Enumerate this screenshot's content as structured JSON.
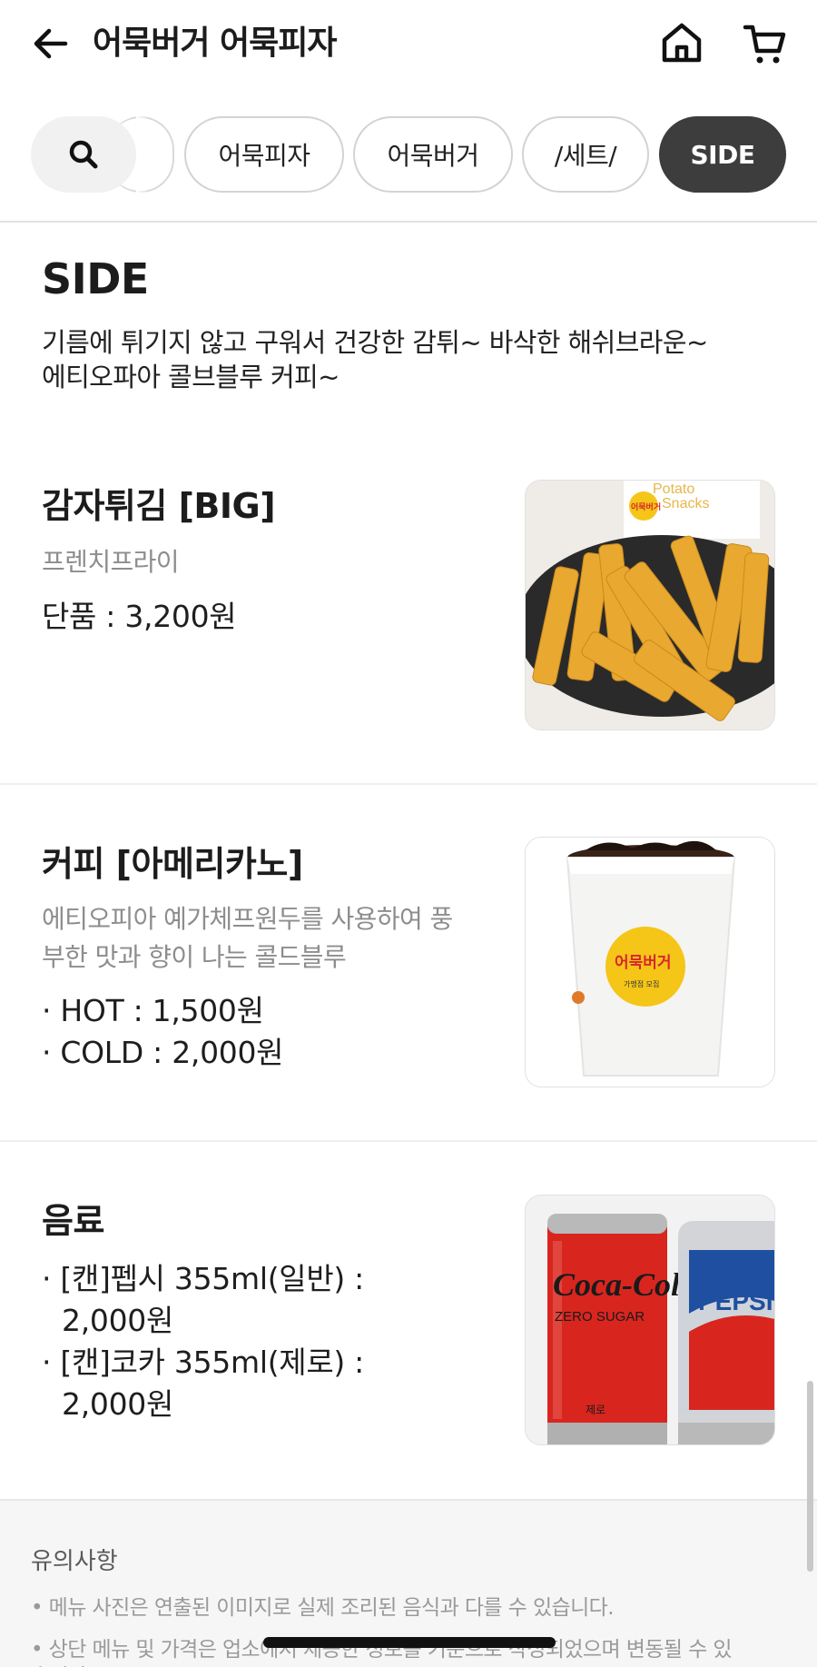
{
  "header": {
    "title": "어묵버거 어묵피자"
  },
  "tabs": [
    {
      "label": "어묵피자"
    },
    {
      "label": "어묵버거"
    },
    {
      "label": "/세트/"
    },
    {
      "label": "SIDE"
    }
  ],
  "section": {
    "title": "SIDE",
    "description_lines": [
      "기름에 튀기지 않고 구워서 건강한 감튀~ 바삭한 해쉬브라운~",
      "에티오파아 콜브블루 커피~"
    ]
  },
  "items": [
    {
      "name": "감자튀김  [BIG]",
      "desc_lines": [
        "프렌치프라이"
      ],
      "price_lines": [
        "단품 : 3,200원"
      ]
    },
    {
      "name": "커피 [아메리카노]",
      "desc_lines": [
        "에티오피아 예가체프원두를 사용하여 풍",
        "부한 맛과 향이 나는 콜드블루"
      ],
      "price_lines": [
        "· HOT : 1,500원",
        "· COLD : 2,000원"
      ]
    },
    {
      "name": "음료",
      "desc_lines": [],
      "price_lines": [
        "· [캔]펩시 355ml(일반) :",
        "2,000원",
        "· [캔]코카 355ml(제로) :",
        "2,000원"
      ]
    }
  ],
  "image_text": {
    "fries_bag": [
      "Potato",
      "Snacks"
    ],
    "fries_logo": "어묵버거",
    "cup_logo": "어묵버거",
    "cup_sub": "가맹점 모집",
    "coke_brand": "Coca-Cola",
    "coke_sub": "ZERO SUGAR",
    "coke_bottom": "제로",
    "pepsi_brand": "PEPSI"
  },
  "notice": {
    "title": "유의사항",
    "lines": [
      "• 메뉴 사진은 연출된 이미지로 실제 조리된 음식과 다를 수 있습니다.",
      "• 상단 메뉴 및 가격은 업소에서 제공한 정보를 기준으로 작성되었으며 변동될 수 있",
      "  습니다."
    ]
  },
  "colors": {
    "active_tab": "#3d3d3d",
    "accent_yellow": "#f5c518",
    "logo_red": "#d8262c"
  }
}
